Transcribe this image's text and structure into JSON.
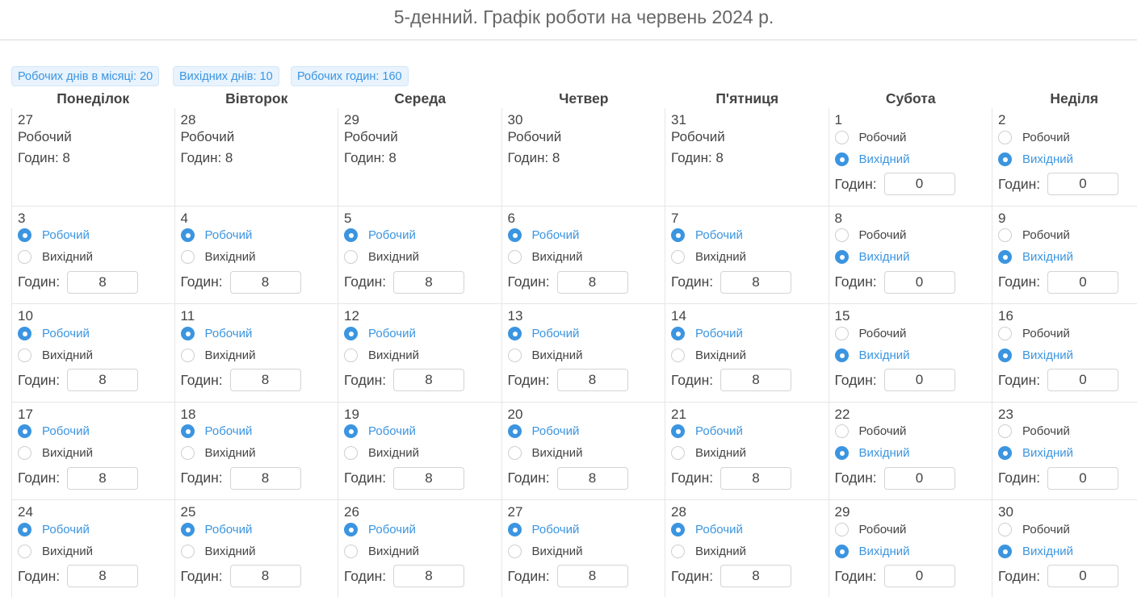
{
  "page": {
    "title": "5-денний. Графік роботи на червень 2024 р."
  },
  "stats": [
    {
      "label": "Робочих днів в місяці: 20"
    },
    {
      "label": "Вихідних днів: 10"
    },
    {
      "label": "Робочих годин: 160"
    }
  ],
  "weekdays": [
    "Понеділок",
    "Вівторок",
    "Середа",
    "Четвер",
    "П'ятниця",
    "Субота",
    "Неділя"
  ],
  "labels": {
    "work": "Робочий",
    "off": "Вихідний",
    "hours": "Годин:",
    "hours_static": "Годин: 8"
  },
  "colors": {
    "accent": "#3b95e0",
    "badge_bg": "#e8f3fd",
    "text": "#444444"
  },
  "weeks": [
    [
      {
        "day": "27",
        "mode": "static",
        "type": "Робочий",
        "hours": "8"
      },
      {
        "day": "28",
        "mode": "static",
        "type": "Робочий",
        "hours": "8"
      },
      {
        "day": "29",
        "mode": "static",
        "type": "Робочий",
        "hours": "8"
      },
      {
        "day": "30",
        "mode": "static",
        "type": "Робочий",
        "hours": "8"
      },
      {
        "day": "31",
        "mode": "static",
        "type": "Робочий",
        "hours": "8"
      },
      {
        "day": "1",
        "mode": "edit",
        "selected": "off",
        "hours": "0"
      },
      {
        "day": "2",
        "mode": "edit",
        "selected": "off",
        "hours": "0"
      }
    ],
    [
      {
        "day": "3",
        "mode": "edit",
        "selected": "work",
        "hours": "8"
      },
      {
        "day": "4",
        "mode": "edit",
        "selected": "work",
        "hours": "8"
      },
      {
        "day": "5",
        "mode": "edit",
        "selected": "work",
        "hours": "8"
      },
      {
        "day": "6",
        "mode": "edit",
        "selected": "work",
        "hours": "8"
      },
      {
        "day": "7",
        "mode": "edit",
        "selected": "work",
        "hours": "8"
      },
      {
        "day": "8",
        "mode": "edit",
        "selected": "off",
        "hours": "0"
      },
      {
        "day": "9",
        "mode": "edit",
        "selected": "off",
        "hours": "0"
      }
    ],
    [
      {
        "day": "10",
        "mode": "edit",
        "selected": "work",
        "hours": "8"
      },
      {
        "day": "11",
        "mode": "edit",
        "selected": "work",
        "hours": "8"
      },
      {
        "day": "12",
        "mode": "edit",
        "selected": "work",
        "hours": "8"
      },
      {
        "day": "13",
        "mode": "edit",
        "selected": "work",
        "hours": "8"
      },
      {
        "day": "14",
        "mode": "edit",
        "selected": "work",
        "hours": "8"
      },
      {
        "day": "15",
        "mode": "edit",
        "selected": "off",
        "hours": "0"
      },
      {
        "day": "16",
        "mode": "edit",
        "selected": "off",
        "hours": "0"
      }
    ],
    [
      {
        "day": "17",
        "mode": "edit",
        "selected": "work",
        "hours": "8"
      },
      {
        "day": "18",
        "mode": "edit",
        "selected": "work",
        "hours": "8"
      },
      {
        "day": "19",
        "mode": "edit",
        "selected": "work",
        "hours": "8"
      },
      {
        "day": "20",
        "mode": "edit",
        "selected": "work",
        "hours": "8"
      },
      {
        "day": "21",
        "mode": "edit",
        "selected": "work",
        "hours": "8"
      },
      {
        "day": "22",
        "mode": "edit",
        "selected": "off",
        "hours": "0"
      },
      {
        "day": "23",
        "mode": "edit",
        "selected": "off",
        "hours": "0"
      }
    ],
    [
      {
        "day": "24",
        "mode": "edit",
        "selected": "work",
        "hours": "8"
      },
      {
        "day": "25",
        "mode": "edit",
        "selected": "work",
        "hours": "8"
      },
      {
        "day": "26",
        "mode": "edit",
        "selected": "work",
        "hours": "8"
      },
      {
        "day": "27",
        "mode": "edit",
        "selected": "work",
        "hours": "8"
      },
      {
        "day": "28",
        "mode": "edit",
        "selected": "work",
        "hours": "8"
      },
      {
        "day": "29",
        "mode": "edit",
        "selected": "off",
        "hours": "0"
      },
      {
        "day": "30",
        "mode": "edit",
        "selected": "off",
        "hours": "0"
      }
    ]
  ]
}
